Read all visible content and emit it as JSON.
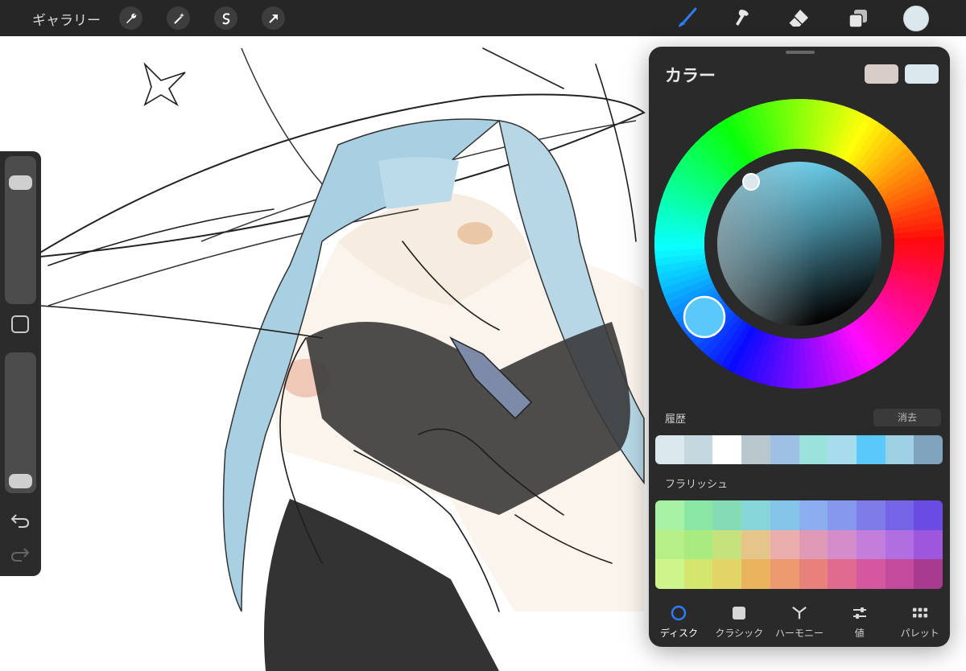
{
  "topbar": {
    "gallery_label": "ギャラリー",
    "left_tools": [
      "wrench-icon",
      "magic-wand-icon",
      "selection-icon",
      "transform-arrow-icon"
    ],
    "right_tools": [
      "brush-icon",
      "smudge-icon",
      "eraser-icon",
      "layers-icon"
    ],
    "current_color": "#dbe9ef",
    "accent": "#2d7cf6"
  },
  "sidebar": {
    "size_slider_value": 0.88,
    "opacity_slider_value": 0.0,
    "controls": [
      "modify-square-icon",
      "undo-icon",
      "redo-icon"
    ]
  },
  "color_panel": {
    "title": "カラー",
    "previous_color": "#d8cdc9",
    "current_color": "#dbe9ef",
    "mode_disc_hue_color": "#5ac8fa",
    "history_label": "履歴",
    "clear_label": "消去",
    "history_colors": [
      "#dbe9ef",
      "#c4d8e0",
      "#ffffff",
      "#b8c7cc",
      "#9ec0e4",
      "#9ce2dc",
      "#a7dcec",
      "#5ac8fa",
      "#9cd0e2",
      "#7fa3bc"
    ],
    "palette_label": "フラリッシュ",
    "palette_colors": [
      "#a6f1a4",
      "#8ae6a4",
      "#86dbb7",
      "#86d5d9",
      "#85c5ea",
      "#8aaef0",
      "#8598ee",
      "#7e7ce8",
      "#7464e6",
      "#6a4ce4",
      "#b6ef86",
      "#aaeb80",
      "#c6e27c",
      "#e6c58a",
      "#eaaeac",
      "#e09ab6",
      "#d48ccb",
      "#c37edc",
      "#b06ee0",
      "#9e56dc",
      "#cdf58c",
      "#d4e66e",
      "#e2d466",
      "#eab45e",
      "#ed9a70",
      "#e8817c",
      "#e06a90",
      "#d457a0",
      "#c44a9e",
      "#a83a90"
    ],
    "tabs": [
      {
        "label": "ディスク",
        "icon": "disc-icon",
        "active": true
      },
      {
        "label": "クラシック",
        "icon": "classic-square-icon",
        "active": false
      },
      {
        "label": "ハーモニー",
        "icon": "harmony-icon",
        "active": false
      },
      {
        "label": "値",
        "icon": "sliders-icon",
        "active": false
      },
      {
        "label": "パレット",
        "icon": "palette-grid-icon",
        "active": false
      }
    ]
  }
}
